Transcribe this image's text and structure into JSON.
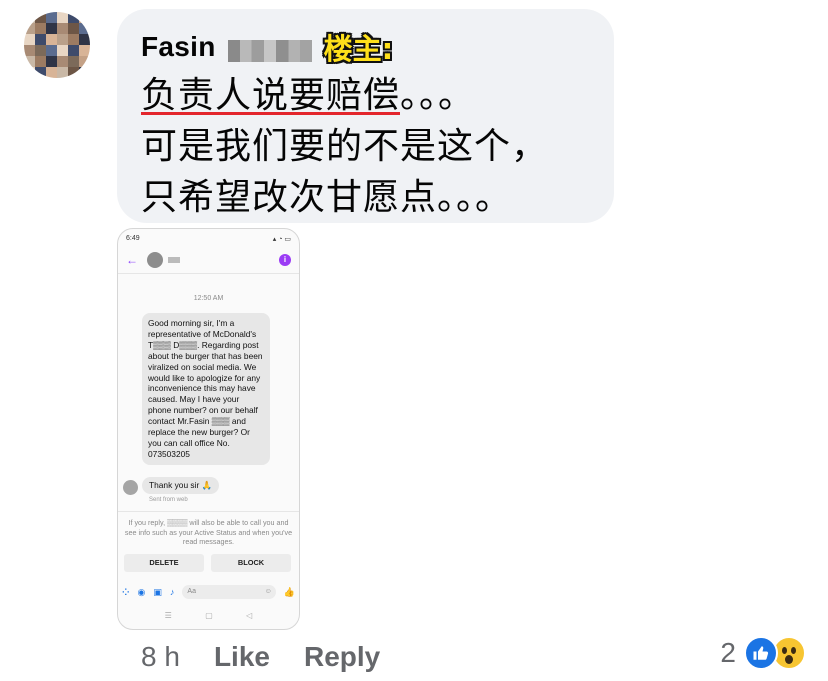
{
  "comment": {
    "author": "Fasin",
    "op_badge": "楼主:",
    "lines": [
      "负责人说要赔偿",
      "。。。",
      "可是我们要的不是这个，",
      "只希望改次甘愿点。。。"
    ]
  },
  "attachment": {
    "status_time": "6:49",
    "time_label": "12:50 AM",
    "message": "Good morning sir, I'm a representative of McDonald's T▒▒▒ D▒▒▒. Regarding post about the burger that has been viralized on social media. We would like to apologize for any inconvenience this may have caused. May I have your phone number? on our behalf contact Mr.Fasin ▒▒▒ and replace the new burger? Or you can call office No. 073503205",
    "reply": "Thank you sir 🙏",
    "sent_label": "Sent from web",
    "notice": "If you reply, ▒▒▒▒ will also be able to call you and see info such as your Active Status and when you've read messages.",
    "delete_label": "DELETE",
    "block_label": "BLOCK",
    "input_placeholder": "Aa"
  },
  "footer": {
    "time": "8 h",
    "like": "Like",
    "reply": "Reply",
    "reaction_count": "2"
  },
  "icons": [
    "like-reaction-icon",
    "wow-reaction-icon",
    "back-arrow-icon",
    "info-icon",
    "camera-icon",
    "gallery-icon",
    "mic-icon",
    "thumbs-up-icon",
    "apps-icon"
  ],
  "colors": {
    "bubble": "#f0f2f5",
    "underline": "#e3262c",
    "badge": "#ffe01a",
    "like": "#1b74e4",
    "wow": "#f7c531",
    "messenger_accent": "#9b3cf5"
  }
}
